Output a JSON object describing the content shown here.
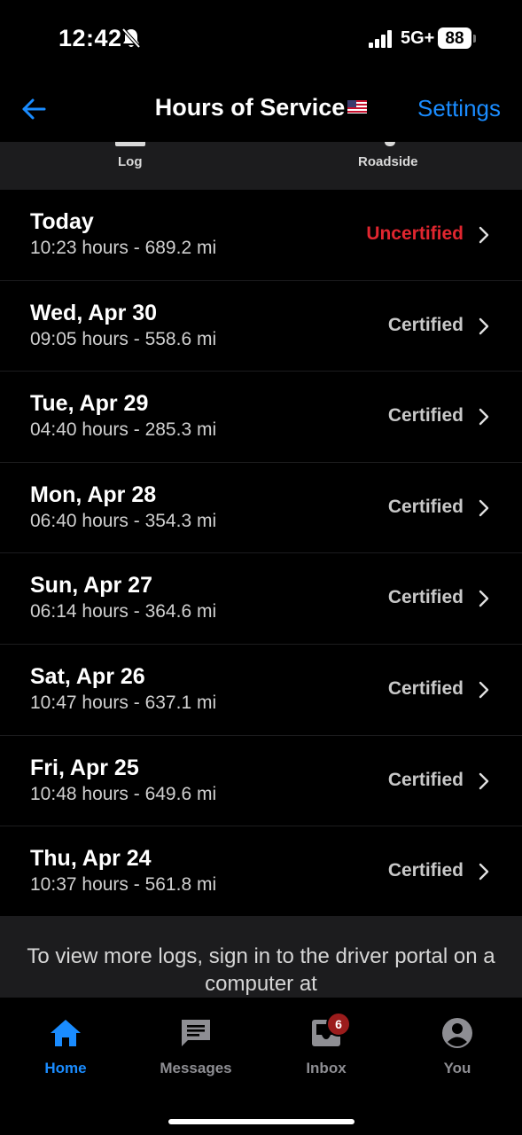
{
  "status_bar": {
    "time": "12:42",
    "network": "5G+",
    "battery": "88",
    "icons": [
      "bell-off-icon",
      "signal-icon",
      "battery-icon"
    ]
  },
  "nav": {
    "title": "Hours of Service",
    "back_icon": "arrow-left-icon",
    "flag_icon": "us-flag-icon",
    "settings_label": "Settings",
    "accent_color": "#1a8cff"
  },
  "tabs": [
    {
      "label": "Log"
    },
    {
      "label": "Roadside"
    }
  ],
  "logs": [
    {
      "date": "Today",
      "summary": "10:23 hours - 689.2 mi",
      "status": "Uncertified"
    },
    {
      "date": "Wed, Apr 30",
      "summary": "09:05 hours - 558.6 mi",
      "status": "Certified"
    },
    {
      "date": "Tue, Apr 29",
      "summary": "04:40 hours - 285.3 mi",
      "status": "Certified"
    },
    {
      "date": "Mon, Apr 28",
      "summary": "06:40 hours - 354.3 mi",
      "status": "Certified"
    },
    {
      "date": "Sun, Apr 27",
      "summary": "06:14 hours - 364.6 mi",
      "status": "Certified"
    },
    {
      "date": "Sat, Apr 26",
      "summary": "10:47 hours - 637.1 mi",
      "status": "Certified"
    },
    {
      "date": "Fri, Apr 25",
      "summary": "10:48 hours - 649.6 mi",
      "status": "Certified"
    },
    {
      "date": "Thu, Apr 24",
      "summary": "10:37 hours - 561.8 mi",
      "status": "Certified"
    }
  ],
  "status_colors": {
    "Uncertified": "#e0262f",
    "Certified": "#c8c8c8"
  },
  "note": "To view more logs, sign in to the driver portal on a computer at",
  "bottom_tabs": [
    {
      "label": "Home",
      "icon": "home-icon",
      "active": true
    },
    {
      "label": "Messages",
      "icon": "message-icon",
      "active": false
    },
    {
      "label": "Inbox",
      "icon": "inbox-icon",
      "active": false,
      "badge": "6"
    },
    {
      "label": "You",
      "icon": "person-icon",
      "active": false
    }
  ]
}
